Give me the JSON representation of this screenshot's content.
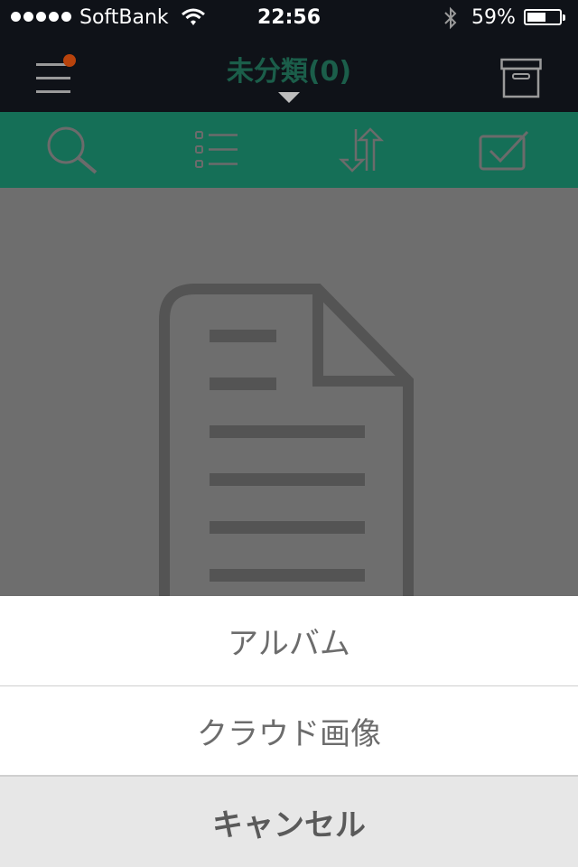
{
  "status_bar": {
    "carrier": "SoftBank",
    "time": "22:56",
    "battery_percent_text": "59%",
    "battery_level": 0.59,
    "signal_icon": "signal-dots-icon",
    "wifi_icon": "wifi-icon",
    "bluetooth_icon": "bluetooth-icon"
  },
  "nav": {
    "title": "未分類(0)",
    "menu_icon": "hamburger-menu-icon",
    "notification_dot_color": "#b8430c",
    "archive_icon": "archive-box-icon"
  },
  "toolbar": {
    "background": "#156f57",
    "items": [
      "search-icon",
      "list-icon",
      "sort-icon",
      "checkbox-icon"
    ]
  },
  "empty_state": {
    "icon": "document-icon"
  },
  "action_sheet": {
    "options": [
      {
        "label": "アルバム"
      },
      {
        "label": "クラウド画像"
      }
    ],
    "cancel_label": "キャンセル"
  }
}
